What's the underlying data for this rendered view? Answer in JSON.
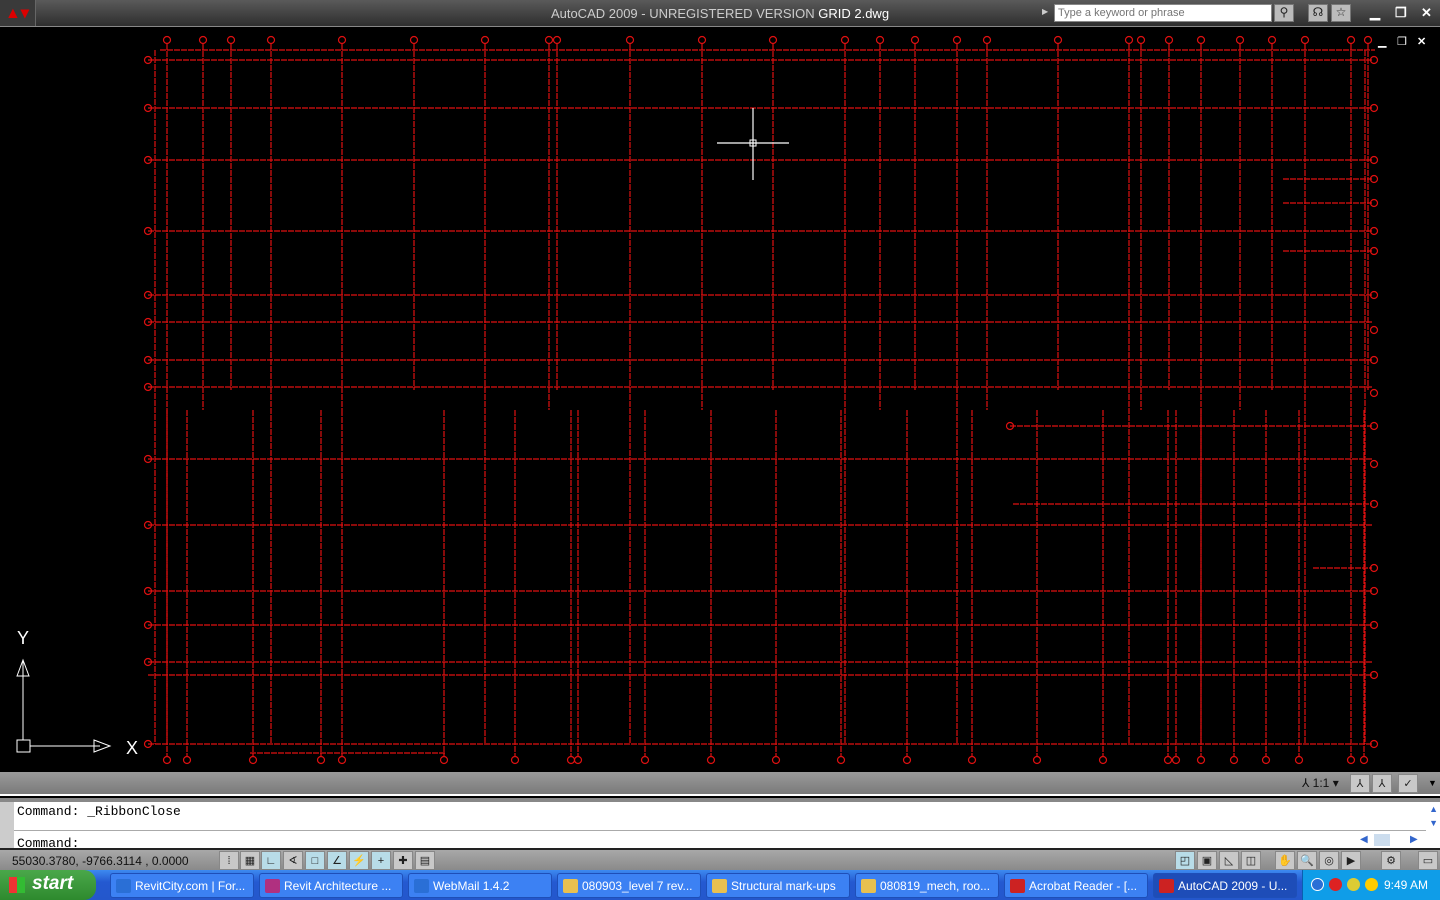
{
  "window": {
    "title_prefix": "AutoCAD 2009 - UNREGISTERED VERSION ",
    "title_file": "GRID 2.dwg",
    "search_placeholder": "Type a keyword or phrase",
    "app_icon": "autocad-logo-icon"
  },
  "canvas": {
    "ucs_x": "X",
    "ucs_y": "Y",
    "drawing_color": "#e01010"
  },
  "annotation": {
    "scale": "1:1"
  },
  "command": {
    "history": "Command:  _RibbonClose",
    "prompt": "Command:"
  },
  "status": {
    "coordinates": "55030.3780, -9766.3114 , 0.0000"
  },
  "taskbar": {
    "start": "start",
    "tasks": [
      "RevitCity.com | For...",
      "Revit Architecture ...",
      "WebMail 1.4.2",
      "080903_level 7 rev...",
      "Structural mark-ups",
      "080819_mech, roo...",
      "Acrobat Reader - [...",
      "AutoCAD 2009 - U..."
    ],
    "clock": "9:49 AM"
  }
}
